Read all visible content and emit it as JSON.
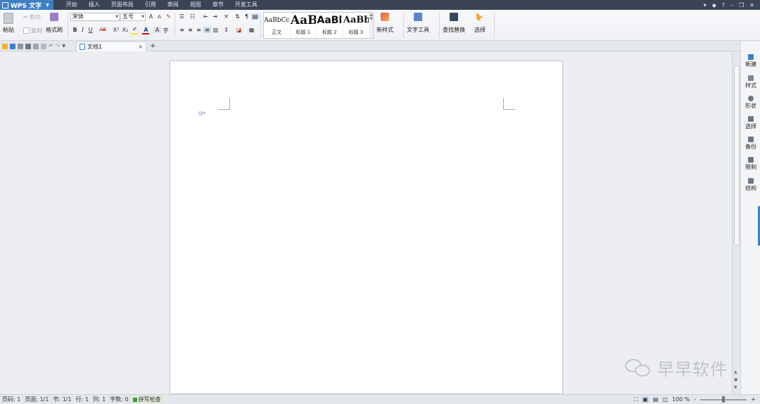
{
  "app": {
    "name": "WPS 文字"
  },
  "menu_tabs": [
    "开始",
    "插入",
    "页面布局",
    "引用",
    "审阅",
    "视图",
    "章节",
    "开发工具"
  ],
  "window_controls": [
    "?"
  ],
  "ribbon": {
    "cut": "剪切",
    "copy": "复制",
    "paste": "粘贴",
    "format_painter": "格式刷",
    "font_name": "宋体",
    "font_size": "五号",
    "bold": "B",
    "italic": "I",
    "underline": "U",
    "strike": "AB",
    "superscript": "X²",
    "subscript": "X₂",
    "font_color": "A",
    "char_shading": "A",
    "grow_font": "A",
    "shrink_font": "A",
    "styles": [
      {
        "sample": "AaBbCcD",
        "label": "正文",
        "size": 9
      },
      {
        "sample": "AaB",
        "label": "标题 1",
        "size": 18
      },
      {
        "sample": "AaBl",
        "label": "标题 2",
        "size": 15
      },
      {
        "sample": "AaBb",
        "label": "标题 3",
        "size": 13
      }
    ],
    "new_style": "新样式",
    "text_tools": "文字工具",
    "find_replace": "查找替换",
    "select": "选择"
  },
  "tabbar": {
    "doc_name": "文档1",
    "close": "×",
    "add": "+"
  },
  "task_pane": [
    "新建",
    "样式",
    "形状",
    "选择",
    "备份",
    "限制",
    "结构"
  ],
  "status": {
    "page_num": "页码: 1",
    "page": "页面: 1/1",
    "section": "节: 1/1",
    "row": "行: 1",
    "col": "列: 1",
    "words": "字数: 0",
    "spell": "拼写检查",
    "zoom": "100 %",
    "zoom_minus": "-",
    "zoom_plus": "+",
    "zoom_level": 0.5
  },
  "watermark": {
    "text": "早早软件"
  },
  "colors": {
    "accent": "#3f7fc5",
    "titlebar": "#3b4454",
    "font_color_bar": "#d0021b",
    "highlight_bar": "#f8e71c"
  }
}
